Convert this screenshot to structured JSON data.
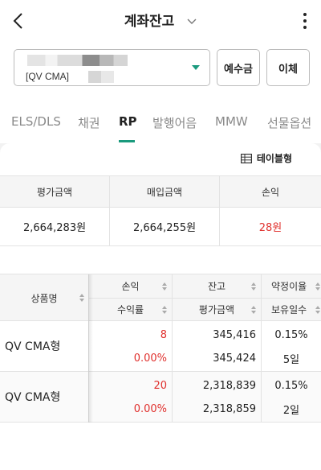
{
  "header": {
    "title": "계좌잔고"
  },
  "account": {
    "label": "[QV CMA]"
  },
  "buttons": {
    "deposit": "예수금",
    "transfer": "이체"
  },
  "tabs": [
    {
      "label": "ELS/DLS"
    },
    {
      "label": "채권"
    },
    {
      "label": "RP",
      "active": true
    },
    {
      "label": "발행어음"
    },
    {
      "label": "MMW"
    },
    {
      "label": "선물옵션"
    }
  ],
  "view": {
    "label": "테이블형"
  },
  "summary": {
    "headers": [
      "평가금액",
      "매입금액",
      "손익"
    ],
    "values": [
      "2,664,283원",
      "2,664,255원",
      "28원"
    ]
  },
  "detail": {
    "headers": {
      "product": "상품명",
      "pnl": "손익",
      "return": "수익률",
      "balance": "잔고",
      "eval": "평가금액",
      "rate": "약정이율",
      "days": "보유일수"
    },
    "rows": [
      {
        "name": "QV CMA형",
        "pnl": "8",
        "return": "0.00%",
        "balance": "345,416",
        "eval": "345,424",
        "rate": "0.15%",
        "days": "5일"
      },
      {
        "name": "QV CMA형",
        "pnl": "20",
        "return": "0.00%",
        "balance": "2,318,839",
        "eval": "2,318,859",
        "rate": "0.15%",
        "days": "2일"
      }
    ]
  },
  "colors": {
    "accent": "#1a9a7d",
    "loss_red": "#e0302d"
  }
}
